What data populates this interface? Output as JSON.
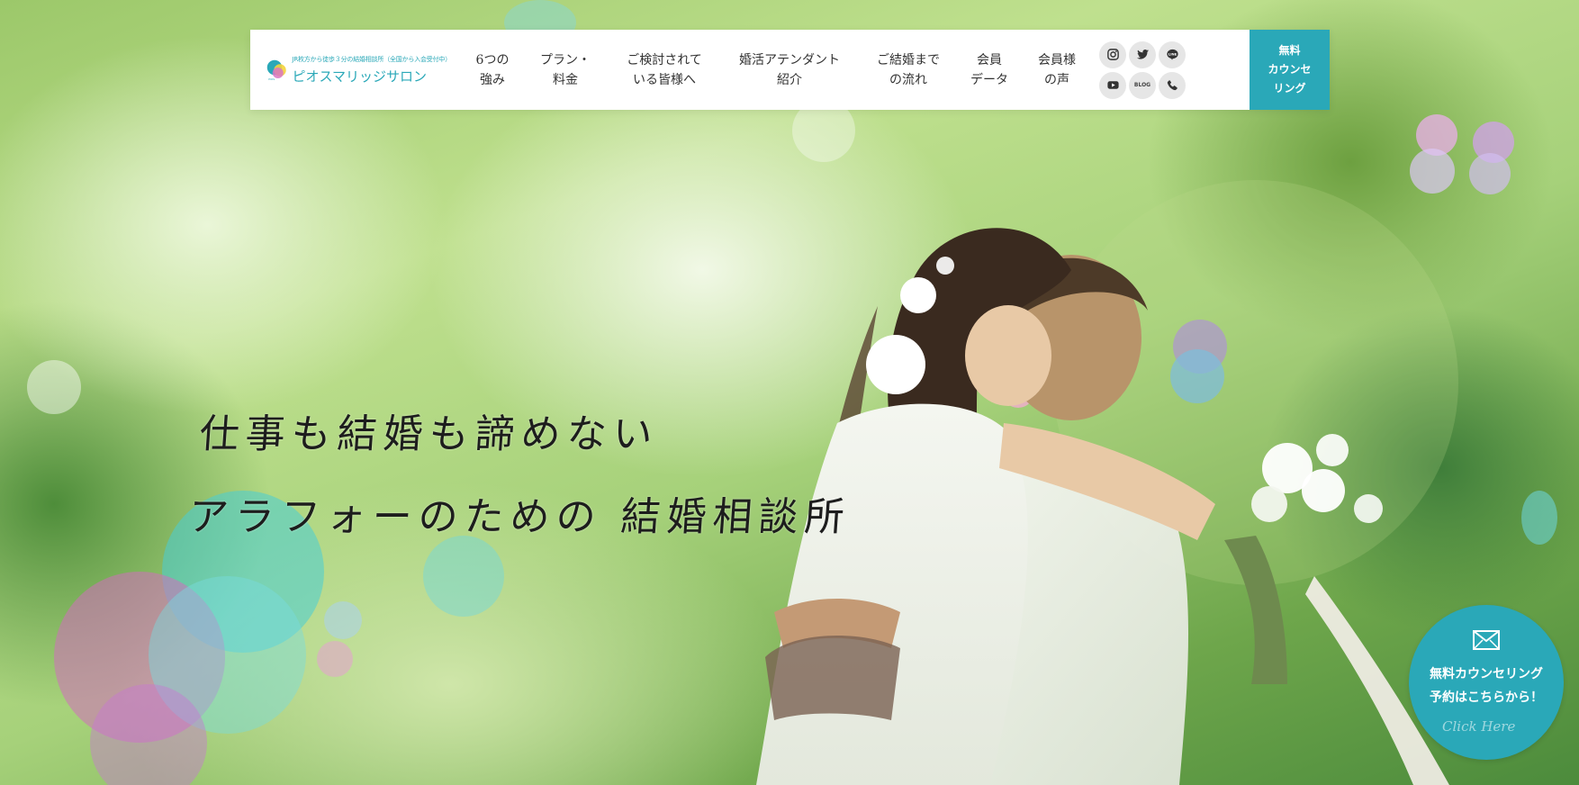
{
  "colors": {
    "brand": "#2aa8b8",
    "header_bg": "#ffffff",
    "text": "#333333"
  },
  "logo": {
    "tagline": "JR枚方から徒歩３分の結婚相談所（全国から入会受付中）",
    "name": "ピオスマリッジサロン"
  },
  "nav": {
    "items": [
      {
        "line1": "6つの",
        "line2": "強み"
      },
      {
        "line1": "プラン・",
        "line2": "料金"
      },
      {
        "line1": "ご検討されて",
        "line2": "いる皆様へ"
      },
      {
        "line1": "婚活アテンダント",
        "line2": "紹介"
      },
      {
        "line1": "ご結婚まで",
        "line2": "の流れ"
      },
      {
        "line1": "会員",
        "line2": "データ"
      },
      {
        "line1": "会員様",
        "line2": "の声"
      }
    ]
  },
  "socials": {
    "icons": [
      "instagram-icon",
      "twitter-icon",
      "line-icon",
      "youtube-icon",
      "blog-icon",
      "phone-icon"
    ],
    "line_label": "LINE",
    "blog_label": "BLOG"
  },
  "cta": {
    "line1": "無料",
    "line2": "カウンセ",
    "line3": "リング"
  },
  "hero": {
    "catch_line1": "仕事も結婚も諦めない",
    "catch_line2": "アラフォーのための 結婚相談所"
  },
  "floating_button": {
    "icon": "mail-icon",
    "line1": "無料カウンセリング",
    "line2": "予約はこちらから！",
    "signature": "Click Here"
  }
}
